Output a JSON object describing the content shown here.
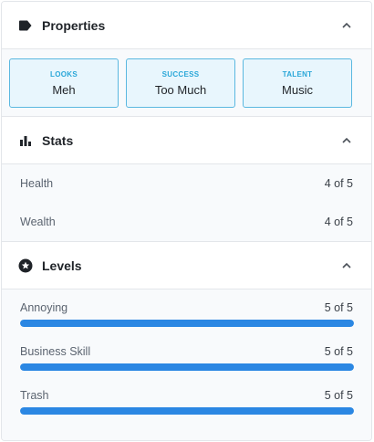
{
  "colors": {
    "accent": "#2b87e3",
    "card_bg": "#e8f6fd",
    "card_border": "#5bb8e0",
    "card_label": "#2aa7d8"
  },
  "properties": {
    "title": "Properties",
    "icon": "tag-icon",
    "cards": [
      {
        "label": "LOOKS",
        "value": "Meh"
      },
      {
        "label": "SUCCESS",
        "value": "Too Much"
      },
      {
        "label": "TALENT",
        "value": "Music"
      }
    ]
  },
  "stats": {
    "title": "Stats",
    "icon": "bar-chart-icon",
    "rows": [
      {
        "label": "Health",
        "value": "4 of 5"
      },
      {
        "label": "Wealth",
        "value": "4 of 5"
      }
    ]
  },
  "levels": {
    "title": "Levels",
    "icon": "star-circle-icon",
    "items": [
      {
        "label": "Annoying",
        "value": "5 of 5",
        "fraction": 1.0
      },
      {
        "label": "Business Skill",
        "value": "5 of 5",
        "fraction": 1.0
      },
      {
        "label": "Trash",
        "value": "5 of 5",
        "fraction": 1.0
      }
    ]
  }
}
